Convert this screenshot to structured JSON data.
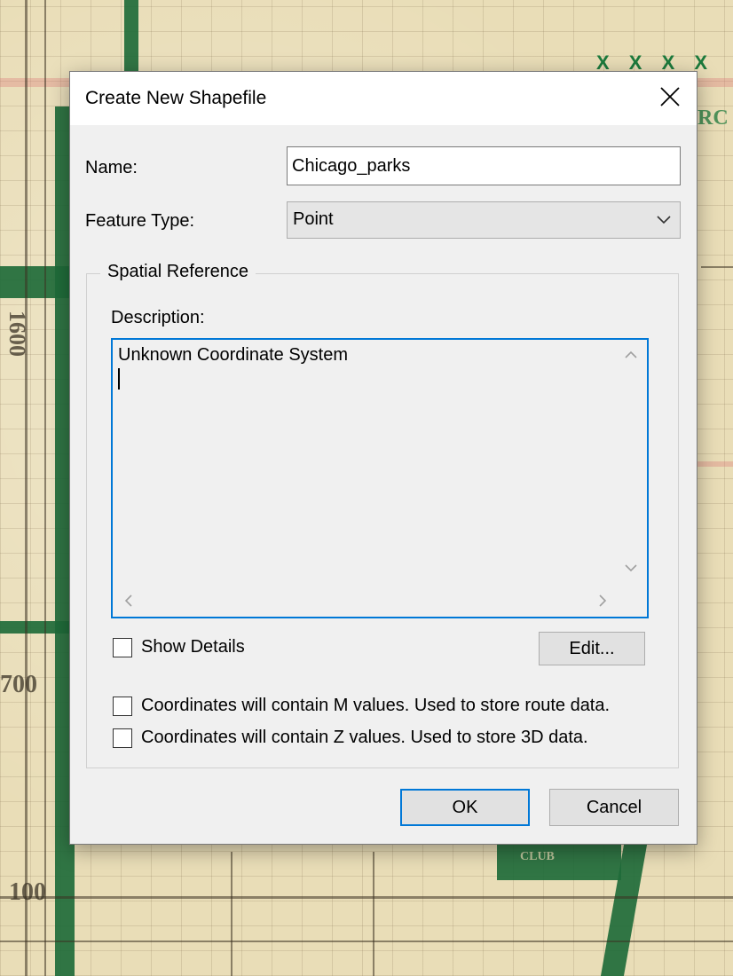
{
  "dialog": {
    "title": "Create New Shapefile",
    "name_label": "Name:",
    "name_value": "Chicago_parks",
    "feature_type_label": "Feature Type:",
    "feature_type_value": "Point",
    "spatial_reference": {
      "legend": "Spatial Reference",
      "description_label": "Description:",
      "description_text": "Unknown Coordinate System",
      "show_details_label": "Show Details",
      "show_details_checked": false,
      "edit_button": "Edit..."
    },
    "m_values_label": "Coordinates will contain M values. Used to store route data.",
    "m_values_checked": false,
    "z_values_label": "Coordinates will contain Z values. Used to store 3D data.",
    "z_values_checked": false,
    "ok_button": "OK",
    "cancel_button": "Cancel"
  },
  "map_labels": {
    "top_marks": "X X X X T",
    "edge_letters": "RC",
    "street_numbers": [
      "1600",
      "700",
      "100"
    ],
    "club": "CLUB"
  },
  "colors": {
    "accent": "#0078d7",
    "dialog_bg": "#f0f0f0",
    "park_green": "#1f6b3a"
  },
  "icons": [
    "close-icon",
    "chevron-down-icon",
    "scroll-up-icon",
    "scroll-down-icon",
    "scroll-left-icon",
    "scroll-right-icon"
  ]
}
